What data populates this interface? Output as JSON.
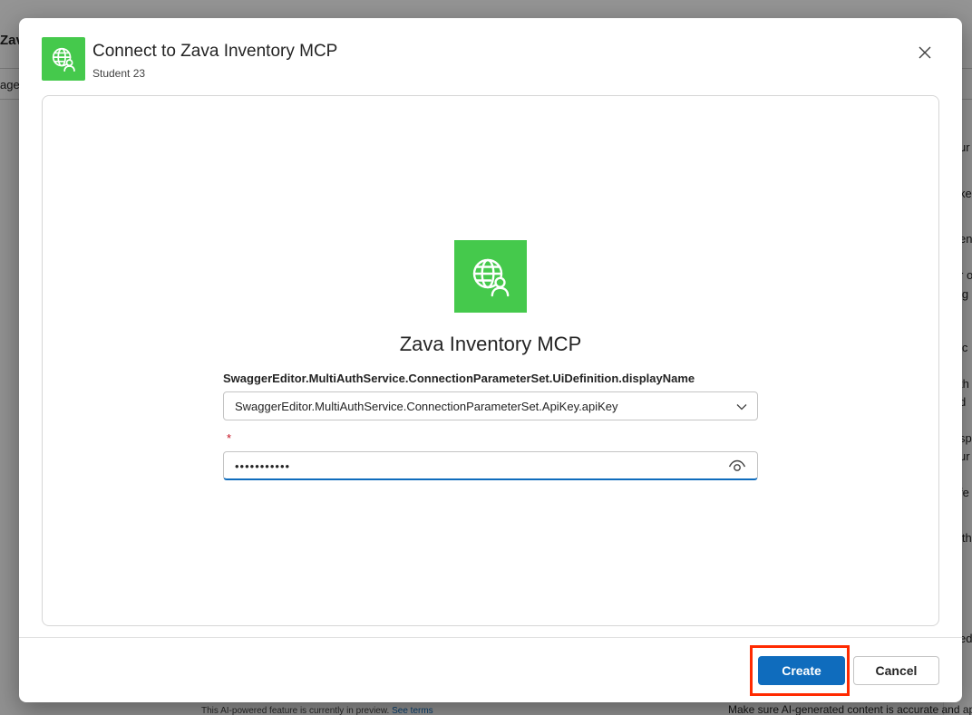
{
  "background": {
    "title_fragment": "Zav",
    "tab_fragment": "agen",
    "right_fragments": [
      "ur",
      "ke",
      "en",
      "r o",
      "ig",
      "ic",
      "th",
      "d",
      "sp",
      "ur",
      "fe",
      "ith",
      "ed"
    ],
    "footer_left_text": "This AI-powered feature is currently in preview.",
    "footer_left_link": "See terms",
    "footer_right_text": "Make sure AI-generated content is accurate and ap"
  },
  "dialog": {
    "title": "Connect to Zava Inventory MCP",
    "subtitle": "Student 23",
    "header_icon": "globe-person-icon",
    "close_icon": "close-icon",
    "connector": {
      "icon": "globe-person-icon",
      "name": "Zava Inventory MCP",
      "brand_color": "#45c94c"
    },
    "auth": {
      "label": "SwaggerEditor.MultiAuthService.ConnectionParameterSet.UiDefinition.displayName",
      "selected": "SwaggerEditor.MultiAuthService.ConnectionParameterSet.ApiKey.apiKey"
    },
    "api_key": {
      "required_marker": "*",
      "value": "•••••••••••"
    },
    "buttons": {
      "create": "Create",
      "cancel": "Cancel"
    },
    "colors": {
      "primary": "#0f6cbd",
      "highlight": "#ff2a00"
    }
  }
}
